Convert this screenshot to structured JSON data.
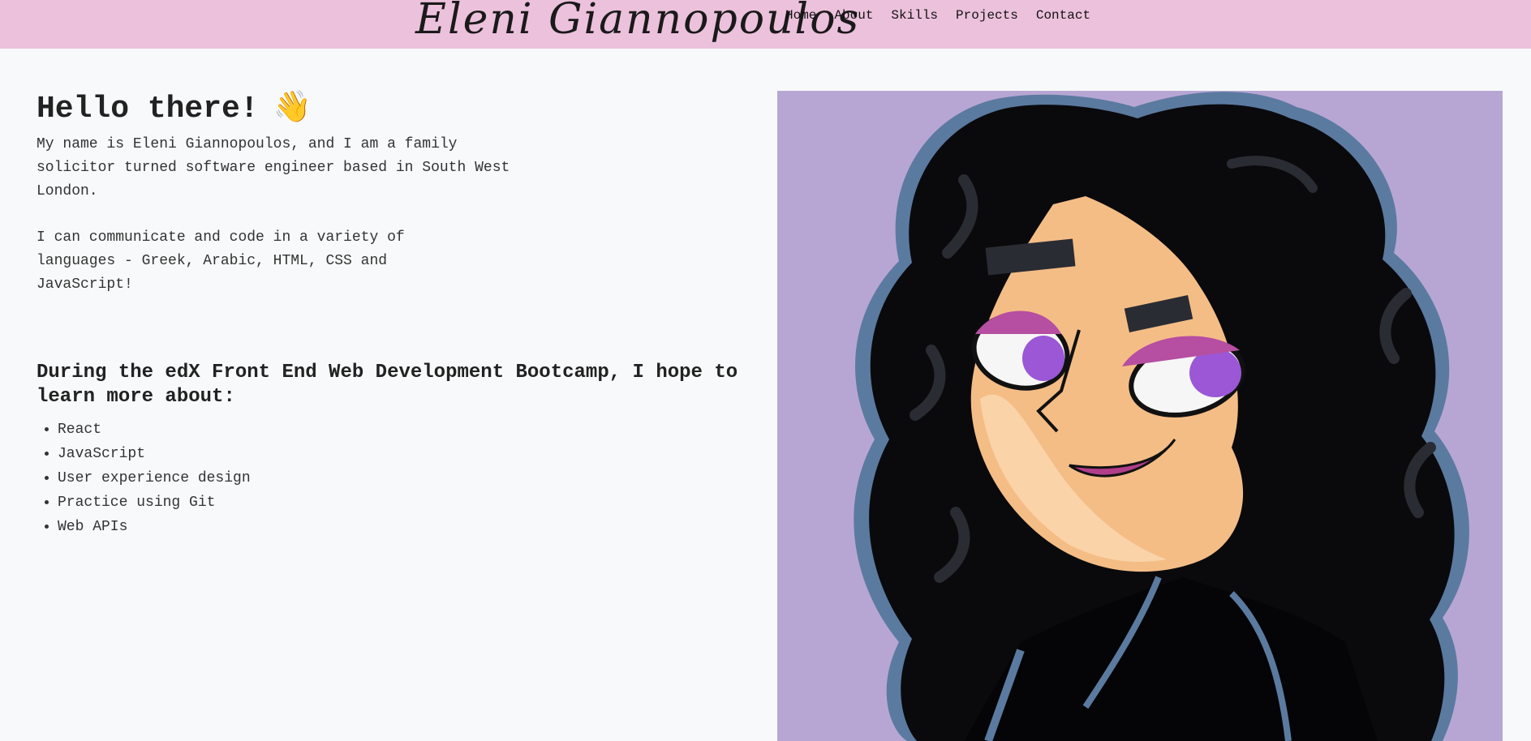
{
  "header": {
    "brand": "Eleni Giannopoulos",
    "nav": [
      "Home",
      "About",
      "Skills",
      "Projects",
      "Contact"
    ]
  },
  "hero": {
    "title": "Hello there!",
    "emoji": "👋",
    "intro": "My name is Eleni Giannopoulos, and I am a family solicitor turned software engineer based in South West London.",
    "languages": "I can communicate and code in a variety of languages - Greek, Arabic, HTML, CSS and JavaScript!"
  },
  "learning": {
    "heading": "During the edX Front End Web Development Bootcamp, I hope to learn more about:",
    "items": [
      "React",
      "JavaScript",
      "User experience design",
      "Practice using Git",
      "Web APIs"
    ]
  },
  "portrait": {
    "icon": "cartoon-portrait-illustration"
  },
  "colors": {
    "navbar": "#ecc1dc",
    "page_background": "#f8f9fa",
    "portrait_background": "#b7a6d3"
  }
}
